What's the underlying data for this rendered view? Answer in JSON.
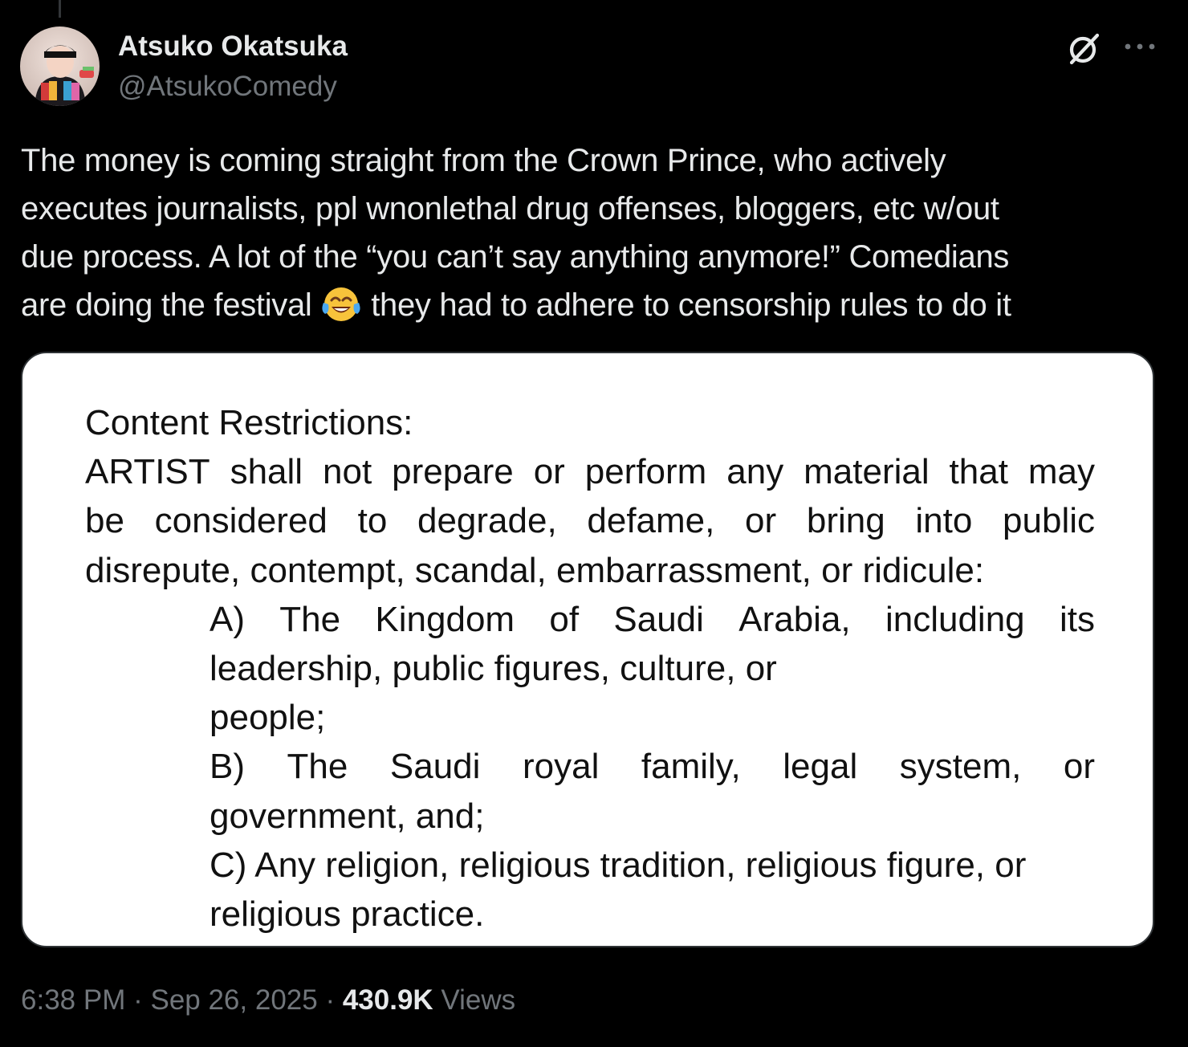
{
  "author": {
    "name": "Atsuko Okatsuka",
    "handle": "@AtsukoComedy"
  },
  "header": {
    "grok_icon": "grok-slash-circle-icon",
    "more_icon": "more-ellipsis-icon"
  },
  "tweet": {
    "lines": [
      "The money is coming straight from the Crown Prince, who actively",
      "executes journalists, ppl wnonlethal drug offenses, bloggers, etc w/out",
      "due process. A lot of the “you can’t say anything anymore!” Comedians",
      "are doing the festival",
      "they had to adhere to censorship rules to do it"
    ],
    "emoji": "😂"
  },
  "media": {
    "title": "Content Restrictions:",
    "para_line1": [
      "ARTIST",
      "shall",
      "not",
      "prepare",
      "or",
      "perform",
      "any",
      "material",
      "that",
      "may"
    ],
    "para_line2": [
      "be",
      "considered",
      "to",
      "degrade,",
      "defame,",
      "or",
      "bring",
      "into",
      "public"
    ],
    "para_line3": "disrepute, contempt, scandal, embarrassment, or ridicule:",
    "a_line1": [
      "A)",
      "The",
      "Kingdom",
      "of",
      "Saudi",
      "Arabia,",
      "including",
      "its"
    ],
    "a_line2": "leadership, public figures, culture, or",
    "a_line3": "people;",
    "b_line1": [
      "B)",
      "The",
      "Saudi",
      "royal",
      "family,",
      "legal",
      "system,",
      "or"
    ],
    "b_line2": "government, and;",
    "c_line1": "C) Any religion, religious tradition, religious figure, or",
    "c_line2": "religious practice."
  },
  "meta": {
    "time": "6:38 PM",
    "sep1": " · ",
    "date": "Sep 26, 2025",
    "sep2": " · ",
    "views_count": "430.9K",
    "views_label": " Views"
  },
  "colors": {
    "background": "#000000",
    "text_primary": "#e7e9ea",
    "text_secondary": "#71767b",
    "border": "#2f3336"
  }
}
